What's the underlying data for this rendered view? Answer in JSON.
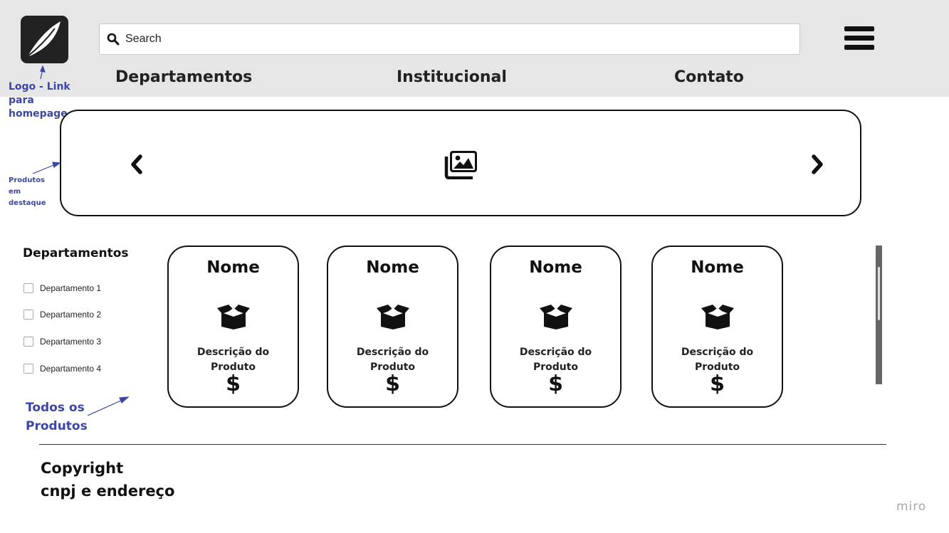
{
  "search": {
    "placeholder": "Search"
  },
  "nav": {
    "items": [
      "Departamentos",
      "Institucional",
      "Contato"
    ]
  },
  "annotations": {
    "logo": [
      "Logo - Link",
      "para",
      "homepage"
    ],
    "destaque": [
      "Produtos",
      "em",
      "destaque"
    ],
    "todos": [
      "Todos os",
      "Produtos"
    ]
  },
  "sidebar": {
    "title": "Departamentos",
    "items": [
      "Departamento 1",
      "Departamento 2",
      "Departamento 3",
      "Departamento 4"
    ]
  },
  "products": [
    {
      "name": "Nome",
      "desc1": "Descrição do",
      "desc2": "Produto",
      "price": "$"
    },
    {
      "name": "Nome",
      "desc1": "Descrição do",
      "desc2": "Produto",
      "price": "$"
    },
    {
      "name": "Nome",
      "desc1": "Descrição do",
      "desc2": "Produto",
      "price": "$"
    },
    {
      "name": "Nome",
      "desc1": "Descrição do",
      "desc2": "Produto",
      "price": "$"
    }
  ],
  "footer": {
    "line1": "Copyright",
    "line2": "cnpj e endereço"
  },
  "watermark": "miro",
  "colors": {
    "annotation": "#3c46a6",
    "header_bg": "#e6e6e6"
  }
}
